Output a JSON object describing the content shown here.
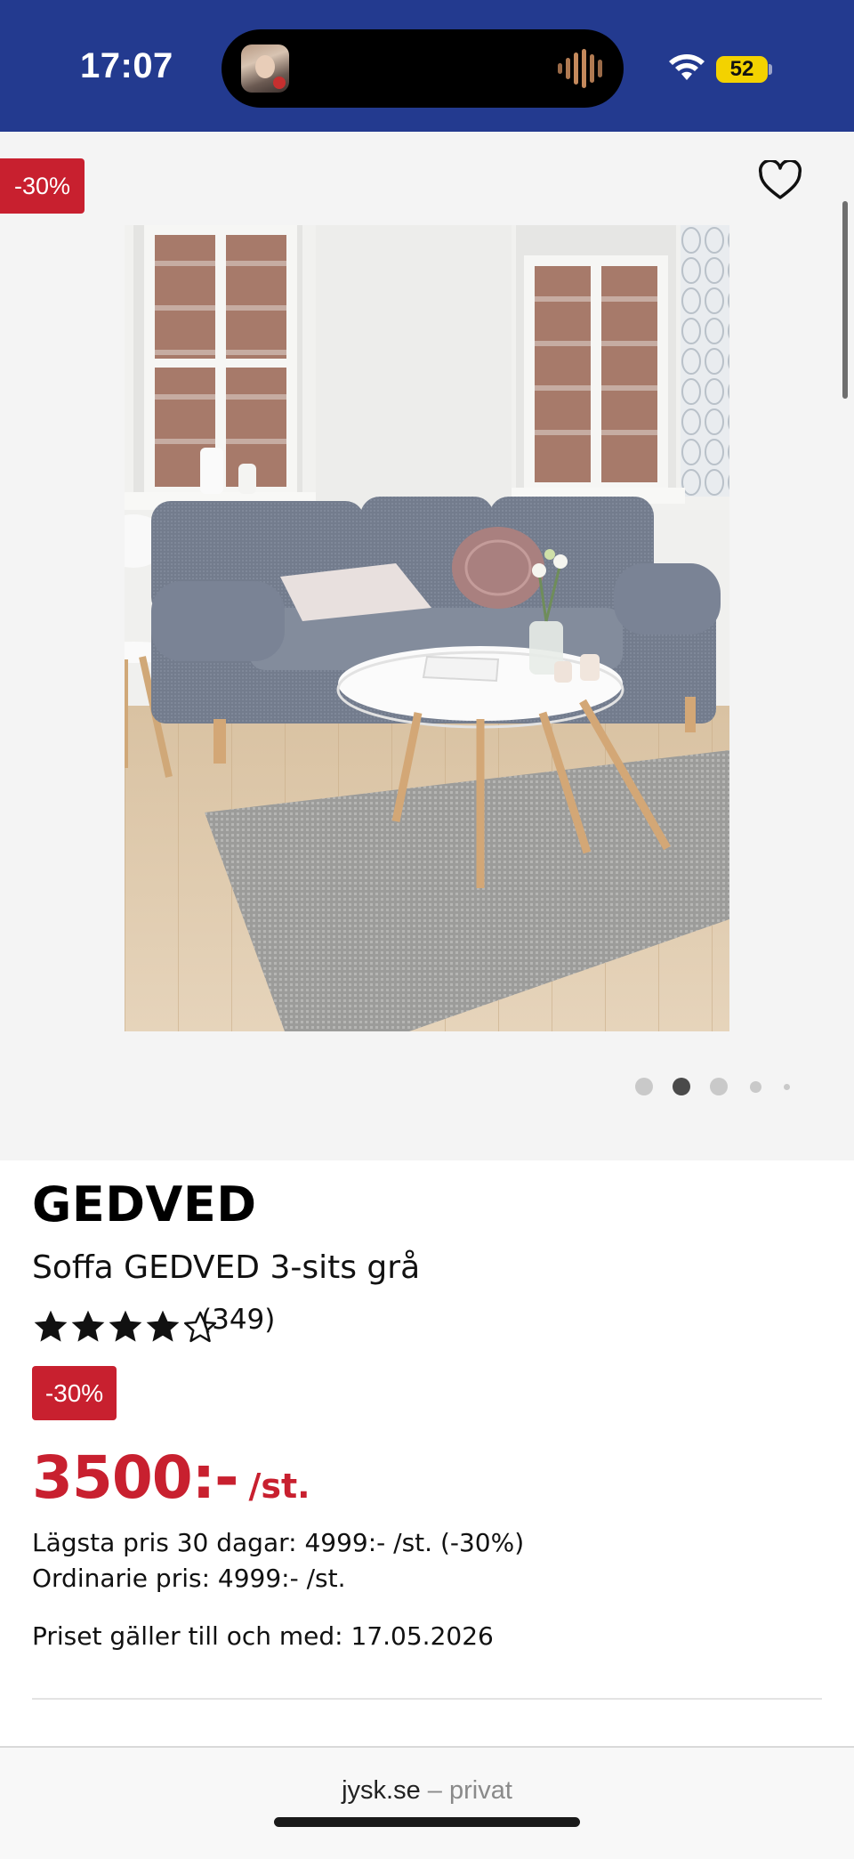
{
  "status_bar": {
    "time": "17:07",
    "battery": "52",
    "wifi_icon": "wifi-icon",
    "background": "#233a8f"
  },
  "gallery": {
    "discount_flag": "-30%",
    "favorite_icon": "heart-icon",
    "image_description_icon": "product-photo",
    "active_dot": 2,
    "dot_count": 5
  },
  "product": {
    "brand": "GEDVED",
    "name": "Soffa GEDVED 3-sits grå",
    "rating": 4,
    "rating_max": 5,
    "review_count": "(349)",
    "discount_badge": "-30%",
    "price": "3500:-",
    "unit": "/st.",
    "lowest_price_30": "Lägsta pris 30 dagar: 4999:- /st. (-30%)",
    "regular_price": "Ordinarie pris: 4999:- /st.",
    "valid_until": "Priset gäller till och med: 17.05.2026"
  },
  "browser": {
    "domain": "jysk.se",
    "separator": " – ",
    "scope": "privat"
  },
  "colors": {
    "accent_red": "#c8202f",
    "header_blue": "#233a8f"
  }
}
